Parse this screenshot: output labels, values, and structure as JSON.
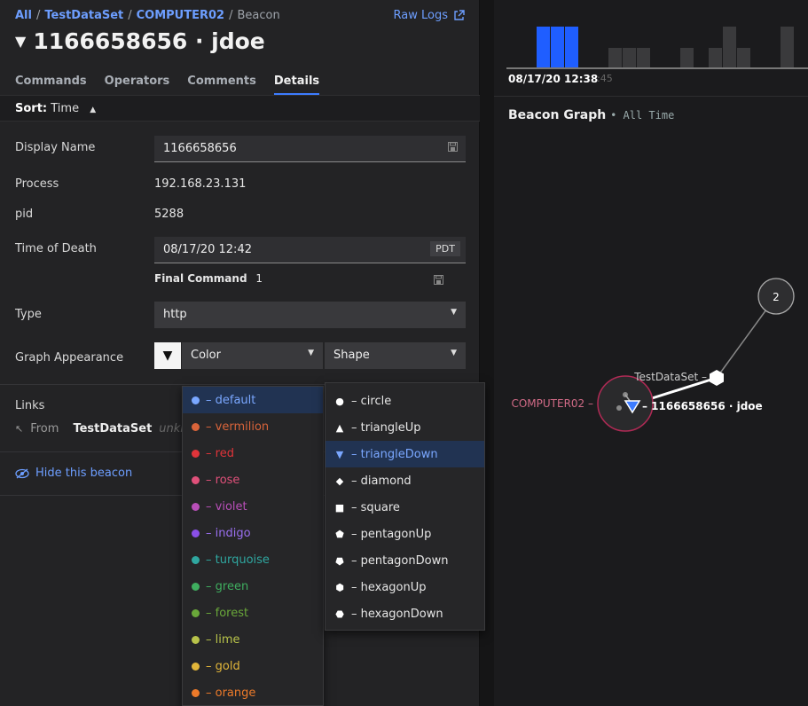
{
  "breadcrumb": {
    "all": "All",
    "dataset": "TestDataSet",
    "host": "COMPUTER02",
    "current": "Beacon"
  },
  "raw_logs_label": "Raw Logs",
  "title": {
    "symbol": "▼",
    "text": "1166658656 · jdoe"
  },
  "tabs": [
    {
      "label": "Commands",
      "active": false
    },
    {
      "label": "Operators",
      "active": false
    },
    {
      "label": "Comments",
      "active": false
    },
    {
      "label": "Details",
      "active": true
    }
  ],
  "sort": {
    "label": "Sort:",
    "value": "Time",
    "arrow": "▲"
  },
  "details": {
    "display_name_label": "Display Name",
    "display_name_value": "1166658656",
    "process_label": "Process",
    "process_value": "192.168.23.131",
    "pid_label": "pid",
    "pid_value": "5288",
    "time_of_death_label": "Time of Death",
    "time_of_death_value": "08/17/20 12:42",
    "timezone": "PDT",
    "final_command_label": "Final Command",
    "final_command_value": "1",
    "type_label": "Type",
    "type_value": "http",
    "graph_appearance_label": "Graph Appearance",
    "shape_symbol": "▼",
    "color_label": "Color",
    "shape_label": "Shape"
  },
  "links": {
    "label": "Links",
    "from_label": "From",
    "from_value": "TestDataSet",
    "from_extra": "unkn"
  },
  "hide_beacon_label": "Hide this beacon",
  "color_options": [
    {
      "label": "– default",
      "color": "#7aa7ff",
      "selected": true
    },
    {
      "label": "– vermilion",
      "color": "#d9643a",
      "selected": false
    },
    {
      "label": "– red",
      "color": "#e0343a",
      "selected": false
    },
    {
      "label": "– rose",
      "color": "#e0507a",
      "selected": false
    },
    {
      "label": "– violet",
      "color": "#b84fb8",
      "selected": false
    },
    {
      "label": "– indigo",
      "color": "#8a4fe8",
      "selected": false
    },
    {
      "label": "– turquoise",
      "color": "#2fa7a0",
      "selected": false
    },
    {
      "label": "– green",
      "color": "#3fae5f",
      "selected": false
    },
    {
      "label": "– forest",
      "color": "#6aa83a",
      "selected": false
    },
    {
      "label": "– lime",
      "color": "#b8c34a",
      "selected": false
    },
    {
      "label": "– gold",
      "color": "#e2b63a",
      "selected": false
    },
    {
      "label": "– orange",
      "color": "#ec7a2a",
      "selected": false
    }
  ],
  "shape_options": [
    {
      "label": "– circle",
      "symbol": "●",
      "selected": false
    },
    {
      "label": "– triangleUp",
      "symbol": "▲",
      "selected": false
    },
    {
      "label": "– triangleDown",
      "symbol": "▼",
      "selected": true
    },
    {
      "label": "– diamond",
      "symbol": "◆",
      "selected": false
    },
    {
      "label": "– square",
      "symbol": "■",
      "selected": false
    },
    {
      "label": "– pentagonUp",
      "symbol": "⬟",
      "selected": false
    },
    {
      "label": "– pentagonDown",
      "symbol": "⬟",
      "selected": false
    },
    {
      "label": "– hexagonUp",
      "symbol": "⬢",
      "selected": false
    },
    {
      "label": "– hexagonDown",
      "symbol": "⬣",
      "selected": false
    }
  ],
  "timeline": {
    "date_label": "08/17/20 12:38",
    "faded_label": ":45"
  },
  "graph": {
    "title": "Beacon Graph",
    "subtitle": "• All Time",
    "count_node": "2",
    "dataset_label": "TestDataSet –",
    "host_label": "COMPUTER02 –",
    "beacon_label": "– 1166658656 · jdoe"
  },
  "colors": {
    "accent": "#3d7cff",
    "link": "#6d9eff",
    "selected_option_bg": "#213352",
    "host_ring": "#c0305a"
  }
}
